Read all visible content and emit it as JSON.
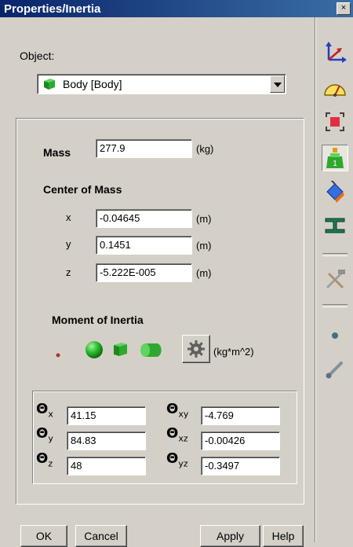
{
  "window": {
    "title": "Properties/Inertia",
    "close_glyph": "×"
  },
  "object": {
    "label": "Object:",
    "selected": "Body  [Body]"
  },
  "mass": {
    "label": "Mass",
    "value": "277.9",
    "unit": "(kg)"
  },
  "center_of_mass": {
    "heading": "Center of Mass",
    "rows": [
      {
        "axis": "x",
        "value": "-0.04645",
        "unit": "(m)"
      },
      {
        "axis": "y",
        "value": "0.1451",
        "unit": "(m)"
      },
      {
        "axis": "z",
        "value": "-5.222E-005",
        "unit": "(m)"
      }
    ]
  },
  "moment": {
    "heading": "Moment of Inertia",
    "unit": "(kg*m^2)",
    "shape_icons": [
      "point-mass-icon",
      "sphere-icon",
      "box-icon",
      "cylinder-icon"
    ],
    "gear_icon": "gear-icon",
    "ixx": {
      "sub": "x",
      "value": "41.15"
    },
    "iyy": {
      "sub": "y",
      "value": "84.83"
    },
    "izz": {
      "sub": "z",
      "value": "48"
    },
    "ixy": {
      "sub": "xy",
      "value": "-4.769"
    },
    "ixz": {
      "sub": "xz",
      "value": "-0.00426"
    },
    "iyz": {
      "sub": "yz",
      "value": "-0.3497"
    },
    "theta_glyph": "Θ"
  },
  "buttons": {
    "ok": "OK",
    "cancel": "Cancel",
    "apply": "Apply",
    "help": "Help"
  },
  "sidebar": {
    "icons": [
      "axes-icon",
      "gauge-icon",
      "frame-icon",
      "inertia-weight-icon",
      "paint-bucket-icon",
      "i-beam-icon",
      "tools-icon",
      "joint-point-icon",
      "link-icon"
    ],
    "selected": "inertia-weight-icon"
  },
  "colors": {
    "titlebar_start": "#0a246a",
    "titlebar_end": "#3a6ea5",
    "face": "#d4d0c8",
    "accent_green": "#2fa82f"
  }
}
